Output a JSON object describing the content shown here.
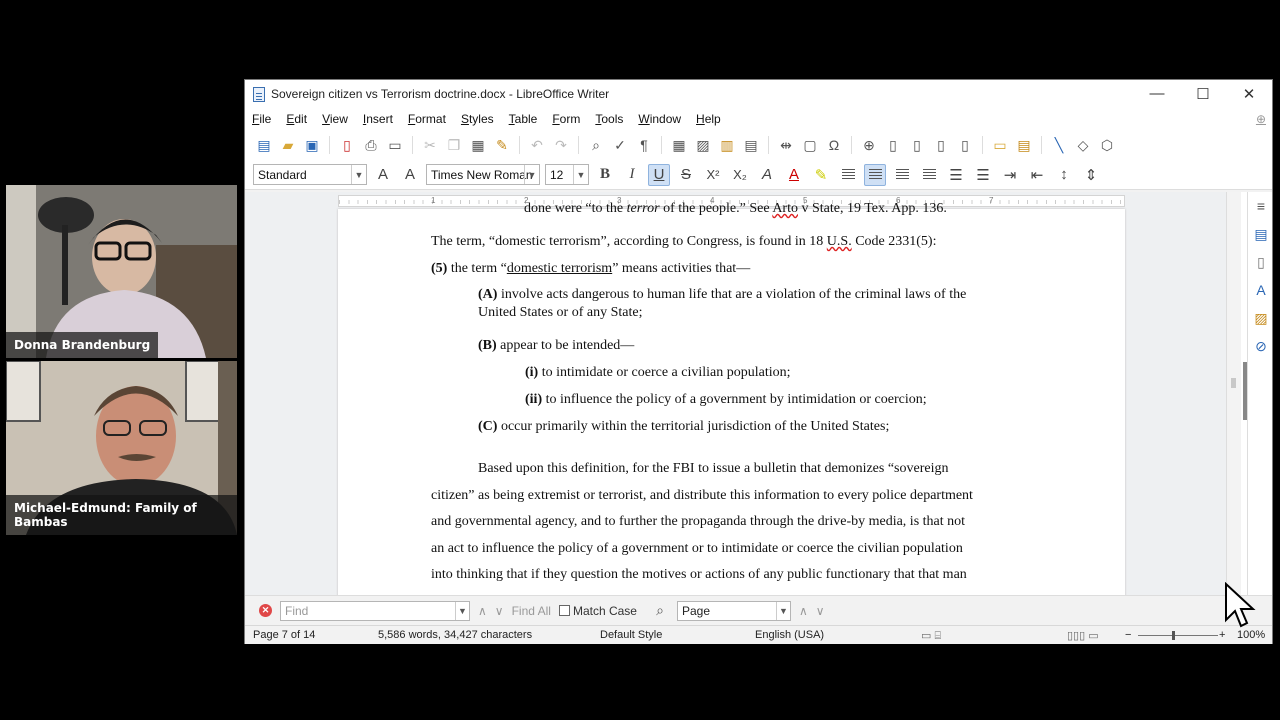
{
  "participants": [
    {
      "name": "Donna Brandenburg"
    },
    {
      "name": "Michael-Edmund: Family of Bambas"
    }
  ],
  "window": {
    "title": "Sovereign citizen vs Terrorism doctrine.docx - LibreOffice Writer",
    "controls": {
      "minimize": "—",
      "maximize": "☐",
      "close": "✕"
    }
  },
  "menu": [
    "File",
    "Edit",
    "View",
    "Insert",
    "Format",
    "Styles",
    "Table",
    "Form",
    "Tools",
    "Window",
    "Help"
  ],
  "formatting": {
    "paragraph_style": "Standard",
    "font_name": "Times New Roman",
    "font_size": "12",
    "active": [
      "underline"
    ]
  },
  "ruler": {
    "numbers": [
      "1",
      "2",
      "3",
      "4",
      "5",
      "6",
      "7"
    ]
  },
  "document": {
    "lines": [
      {
        "text_before": "done were “to the ",
        "italic": "terror",
        "text_after": " of the people.” See ",
        "wavy": "Arto",
        "text_end": " v State, 19 Tex. App. 136."
      },
      {
        "text": "The term, “domestic terrorism”, according to Congress, is found in 18 ",
        "wavy": "U.S.",
        "text_after": " Code 2331(5):"
      },
      {
        "bold": "(5)",
        "text_before": " the term “",
        "underlined": "domestic terrorism",
        "text_after": "” means activities that—"
      },
      {
        "bold": "(A)",
        "text": " involve acts dangerous to human life that are a violation of the criminal laws of the"
      },
      {
        "text": "United States or of any State;"
      },
      {
        "bold": "(B)",
        "text": " appear to be intended—"
      },
      {
        "bold": "(i)",
        "text": " to intimidate or coerce a civilian population;"
      },
      {
        "bold": "(ii)",
        "text": " to influence the policy of a government by intimidation or coercion;"
      },
      {
        "bold": "(C)",
        "text": " occur primarily within the territorial jurisdiction of the United States;"
      },
      {
        "text": "Based upon this definition, for the FBI to issue a bulletin that demonizes “sovereign"
      },
      {
        "text": "citizen” as being extremist or terrorist, and distribute this information to every police department"
      },
      {
        "text": "and governmental agency, and to further the propaganda through the drive-by media, is that not"
      },
      {
        "text": "an act to influence the policy of a government or to intimidate or coerce the civilian population"
      },
      {
        "text": "into thinking that if they question the motives or actions of any public functionary that that man"
      }
    ]
  },
  "find_bar": {
    "placeholder": "Find",
    "find_all": "Find All",
    "match_case": "Match Case",
    "search_scope": "Page"
  },
  "status": {
    "page": "Page 7 of 14",
    "words": "5,586 words, 34,427 characters",
    "style": "Default Style",
    "language": "English (USA)",
    "zoom": "100%"
  }
}
